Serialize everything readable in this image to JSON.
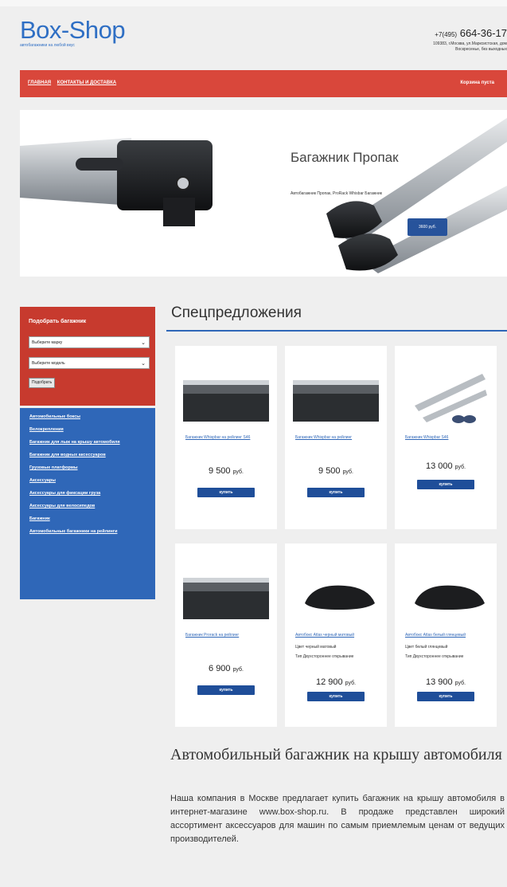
{
  "header": {
    "logo": "Box-Shop",
    "tagline": "автобагажники на любой вкус",
    "phone_code": "+7(495)",
    "phone": "664-36-17",
    "address_line1": "109383, г.Москва, ул.Марксистская, дом",
    "address_line2": "Воскресенье, без выходных"
  },
  "nav": {
    "items": [
      "ГЛАВНАЯ",
      "КОНТАКТЫ И ДОСТАВКА"
    ],
    "cart": "Корзина пуста"
  },
  "hero": {
    "title": "Багажник Пропак",
    "description": "Автобагажник Пропак, ProRack Whisbar Багажник",
    "button": "3600 руб."
  },
  "filter": {
    "title": "Подобрать багажник",
    "make_placeholder": "Выберите марку",
    "model_placeholder": "Выберите модель",
    "button": "Подобрать"
  },
  "catalog": {
    "items": [
      "Автомобильные боксы",
      "Велокрепления",
      "Багажник для лыж на крышу автомобиля",
      "Багажник для водных аксессуаров",
      "Грузовые платформы",
      "Аксессуары",
      "Аксессуары для фиксации груза",
      "Аксессуары для велосипедов",
      "Багажник",
      "Автомобильные багажники на рейлинги"
    ]
  },
  "specials": {
    "title": "Спецпредложения",
    "buy_label": "купить",
    "currency": "руб.",
    "products": [
      {
        "name": "Багажник Whispbar на рейлинг S46",
        "price": "9 500",
        "attr1": "",
        "attr2": ""
      },
      {
        "name": "Багажник Whispbar на рейлинг",
        "price": "9 500",
        "attr1": "",
        "attr2": ""
      },
      {
        "name": "Багажник Whispbar S46",
        "price": "13 000",
        "attr1": "",
        "attr2": ""
      },
      {
        "name": "Багажник Prorack на рейлинг",
        "price": "6 900",
        "attr1": "",
        "attr2": ""
      },
      {
        "name": "Автобокс Atlas черный матовый",
        "price": "12 900",
        "attr1": "Цвет черный матовый",
        "attr2": "Тип Двухстороннее открывание"
      },
      {
        "name": "Автобокс Atlas белый глянцевый",
        "price": "13 900",
        "attr1": "Цвет белый глянцевый",
        "attr2": "Тип Двухстороннее открывание"
      }
    ]
  },
  "article": {
    "heading": "Автомобильный багажник на крышу автомобиля",
    "text": "Наша компания в Москве предлагает купить багажник на крышу автомобиля в интернет-магазине www.box-shop.ru. В продаже представлен широкий ассортимент аксессуаров для машин по самым приемлемым ценам от ведущих производителей."
  },
  "colors": {
    "nav_red": "#d9473b",
    "filter_red": "#c73a2e",
    "catalog_blue": "#2f67b8",
    "button_blue": "#1f4e99",
    "logo_blue": "#2f6fc4"
  }
}
